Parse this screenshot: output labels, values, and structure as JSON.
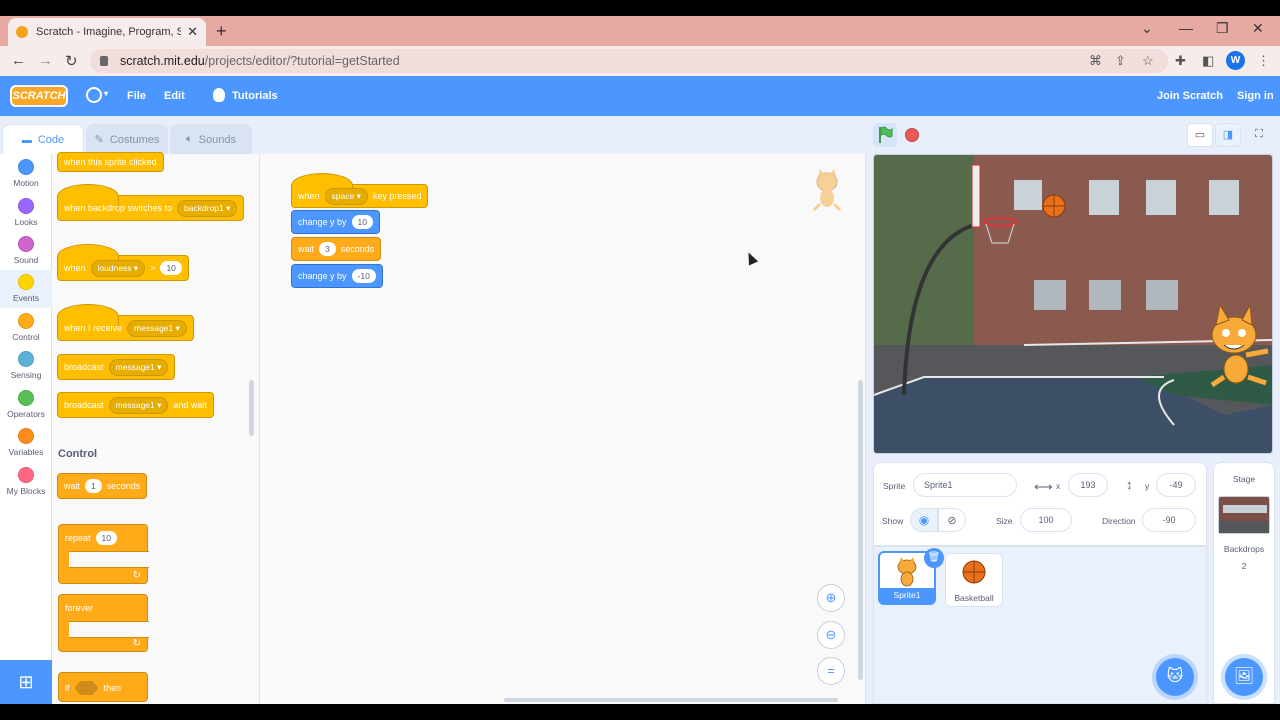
{
  "browser": {
    "tab_title": "Scratch - Imagine, Program, Shar",
    "tab_close": "✕",
    "new_tab": "+",
    "url_host": "scratch.mit.edu",
    "url_path": "/projects/editor/?tutorial=getStarted",
    "profile_initial": "W"
  },
  "menu": {
    "logo": "SCRATCH",
    "file": "File",
    "edit": "Edit",
    "tutorials": "Tutorials",
    "join": "Join Scratch",
    "signin": "Sign in"
  },
  "tabs": {
    "code": "Code",
    "costumes": "Costumes",
    "sounds": "Sounds"
  },
  "categories": [
    {
      "label": "Motion",
      "color": "#4c97ff"
    },
    {
      "label": "Looks",
      "color": "#9966ff"
    },
    {
      "label": "Sound",
      "color": "#cf63cf"
    },
    {
      "label": "Events",
      "color": "#ffd500"
    },
    {
      "label": "Control",
      "color": "#ffab19"
    },
    {
      "label": "Sensing",
      "color": "#5cb1d6"
    },
    {
      "label": "Operators",
      "color": "#59c059"
    },
    {
      "label": "Variables",
      "color": "#ff8c1a"
    },
    {
      "label": "My Blocks",
      "color": "#ff6680"
    }
  ],
  "palette": {
    "when_clicked": "when this sprite clicked",
    "backdrop_switch": "when backdrop switches to",
    "backdrop_value": "backdrop1",
    "when": "when",
    "loudness": "loudness",
    "gt": ">",
    "loudness_value": "10",
    "receive": "when I receive",
    "message": "message1",
    "broadcast": "broadcast",
    "broadcast_wait": "broadcast",
    "and_wait": "and wait",
    "control_head": "Control",
    "wait": "wait",
    "wait_value": "1",
    "seconds": "seconds",
    "repeat": "repeat",
    "repeat_value": "10",
    "forever": "forever",
    "if": "if",
    "then": "then"
  },
  "script": {
    "when": "when",
    "key": "space",
    "key_pressed": "key pressed",
    "change_y": "change y by",
    "change_value_1": "10",
    "wait": "wait",
    "wait_value": "3",
    "seconds": "seconds",
    "change_value_2": "-10"
  },
  "sprite_info": {
    "sprite_label": "Sprite",
    "sprite_name": "Sprite1",
    "x_label": "x",
    "x_value": "193",
    "y_label": "y",
    "y_value": "-49",
    "show_label": "Show",
    "size_label": "Size",
    "size_value": "100",
    "direction_label": "Direction",
    "direction_value": "-90"
  },
  "sprites": [
    {
      "name": "Sprite1",
      "selected": true
    },
    {
      "name": "Basketball",
      "selected": false
    }
  ],
  "stage_panel": {
    "title": "Stage",
    "backdrops_label": "Backdrops",
    "backdrops_count": "2"
  }
}
